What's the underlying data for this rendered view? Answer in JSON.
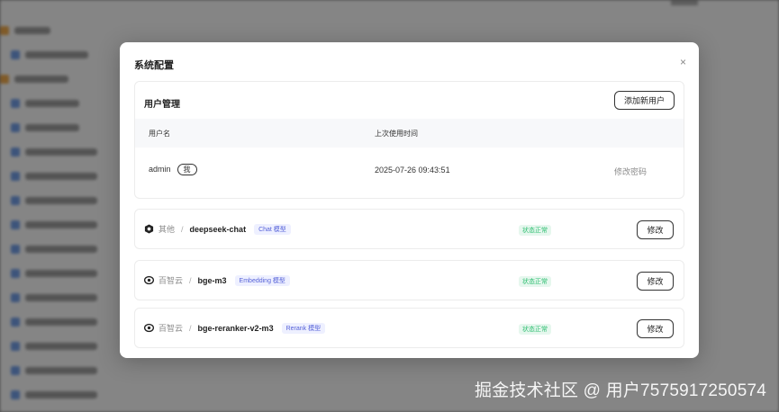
{
  "modal": {
    "title": "系统配置",
    "close_glyph": "×"
  },
  "user_section": {
    "title": "用户管理",
    "add_user_label": "添加新用户",
    "columns": [
      "用户名",
      "上次使用时间"
    ],
    "rows": [
      {
        "username": "admin",
        "badge": "我",
        "last_used": "2025-07-26 09:43:51",
        "action": "修改密码"
      }
    ]
  },
  "models": [
    {
      "icon": "hexagon-icon",
      "provider": "其他",
      "separator": "/",
      "name": "deepseek-chat",
      "type_tag": "Chat 模型",
      "status": "状态正常",
      "edit_label": "修改"
    },
    {
      "icon": "eye-logo-icon",
      "provider": "百智云",
      "separator": "/",
      "name": "bge-m3",
      "type_tag": "Embedding 模型",
      "status": "状态正常",
      "edit_label": "修改"
    },
    {
      "icon": "eye-logo-icon",
      "provider": "百智云",
      "separator": "/",
      "name": "bge-reranker-v2-m3",
      "type_tag": "Rerank 模型",
      "status": "状态正常",
      "edit_label": "修改"
    }
  ],
  "watermark": "掘金技术社区 @ 用户7575917250574",
  "colors": {
    "tag_bg": "#eef0ff",
    "tag_text": "#5662d8",
    "status_bg": "#e6f7ee",
    "status_text": "#2fbf71"
  }
}
